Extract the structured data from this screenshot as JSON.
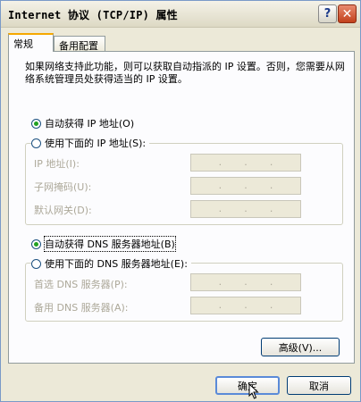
{
  "window": {
    "title": "Internet 协议 (TCP/IP) 属性",
    "help_icon": "?",
    "close_icon": "✕"
  },
  "tabs": [
    {
      "label": "常规",
      "active": true
    },
    {
      "label": "备用配置",
      "active": false
    }
  ],
  "general": {
    "description": "如果网络支持此功能，则可以获取自动指派的 IP 设置。否则，您需要从网络系统管理员处获得适当的 IP 设置。",
    "ip_auto": {
      "label": "自动获得 IP 地址(O)",
      "selected": true
    },
    "ip_manual": {
      "label": "使用下面的 IP 地址(S):",
      "selected": false
    },
    "ip_fields": [
      {
        "label": "IP 地址(I):",
        "value": ""
      },
      {
        "label": "子网掩码(U):",
        "value": ""
      },
      {
        "label": "默认网关(D):",
        "value": ""
      }
    ],
    "dns_auto": {
      "label": "自动获得 DNS 服务器地址(B)",
      "selected": true
    },
    "dns_manual": {
      "label": "使用下面的 DNS 服务器地址(E):",
      "selected": false
    },
    "dns_fields": [
      {
        "label": "首选 DNS 服务器(P):",
        "value": ""
      },
      {
        "label": "备用 DNS 服务器(A):",
        "value": ""
      }
    ],
    "advanced_label": "高级(V)..."
  },
  "footer": {
    "ok_label": "确定",
    "cancel_label": "取消"
  },
  "colors": {
    "dialog_bg": "#ece9d8",
    "radio_dot": "#21a121",
    "tab_highlight": "#f6a800",
    "disabled_text": "#aca899"
  }
}
